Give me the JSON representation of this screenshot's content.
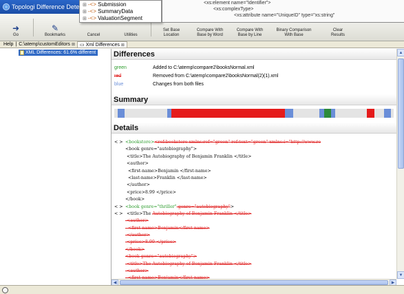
{
  "window": {
    "title": "Topologi Difference Detect"
  },
  "toolbar": {
    "buttons": [
      {
        "label": "Go",
        "icon": "go-icon"
      },
      {
        "label": "Bookmarks",
        "icon": "bookmark-icon"
      },
      {
        "label": "Cancel",
        "icon": ""
      },
      {
        "label": "Utilities",
        "icon": ""
      },
      {
        "label": "Set Base\nLocation",
        "icon": ""
      },
      {
        "label": "Compare With\nBase by Word",
        "icon": ""
      },
      {
        "label": "Compare With\nBase by Line",
        "icon": ""
      },
      {
        "label": "Binary Comparison\nWith Base",
        "icon": ""
      },
      {
        "label": "Clear\nResults",
        "icon": ""
      }
    ]
  },
  "dropdown": {
    "items": [
      "Submission",
      "SummaryData",
      "ValuationSegment"
    ]
  },
  "code_popup": {
    "lines": [
      "<xs:element name=\"Identifier\">",
      "<xs:complexType>",
      "<xs:attribute name=\"UniqueID\" type=\"xs:string\""
    ]
  },
  "tabs": {
    "help": "Help",
    "path_tab": "C:\\atemp\\customEditors",
    "active_tab": "Xml Differences"
  },
  "tree": {
    "selected_item": "XML Differences: 61.6% different"
  },
  "differences": {
    "heading": "Differences",
    "rows": [
      {
        "key": "green",
        "text": "Added to C:\\atemp\\compare2\\booksNormal.xml"
      },
      {
        "key": "red",
        "text": "Removed from C:\\atemp\\compare2\\booksNormal(2)(1).xml"
      },
      {
        "key": "blue",
        "text": "Changes from both files"
      }
    ]
  },
  "summary": {
    "heading": "Summary",
    "segments": [
      {
        "start": 0.013,
        "end": 0.038,
        "color": "#6a8ed8"
      },
      {
        "start": 0.19,
        "end": 0.205,
        "color": "#6a8ed8"
      },
      {
        "start": 0.205,
        "end": 0.61,
        "color": "#e51b1b"
      },
      {
        "start": 0.61,
        "end": 0.64,
        "color": "#6a8ed8"
      },
      {
        "start": 0.735,
        "end": 0.752,
        "color": "#6a8ed8"
      },
      {
        "start": 0.752,
        "end": 0.775,
        "color": "#2c8a3c"
      },
      {
        "start": 0.775,
        "end": 0.79,
        "color": "#6a8ed8"
      },
      {
        "start": 0.905,
        "end": 0.93,
        "color": "#e51b1b"
      },
      {
        "start": 0.965,
        "end": 0.99,
        "color": "#6a8ed8"
      }
    ]
  },
  "details": {
    "heading": "Details",
    "lines": [
      {
        "arrow": "< >",
        "parts": [
          {
            "t": "<bookstore>",
            "s": "add"
          },
          {
            "t": "<ref:bookstore xmlns:ref=\"green\" ref:text=\"green\" xmlns:i=\"http://www.re",
            "s": "del"
          }
        ]
      },
      {
        "arrow": "",
        "parts": [
          {
            "t": "<book genre=\"autobiography\">",
            "s": "plain"
          }
        ]
      },
      {
        "arrow": "",
        "parts": [
          {
            "t": " <title>The Autobiography of Benjamin Franklin </title>",
            "s": "plain"
          }
        ]
      },
      {
        "arrow": "",
        "parts": [
          {
            "t": " <author>",
            "s": "plain"
          }
        ]
      },
      {
        "arrow": "",
        "parts": [
          {
            "t": "  <first-name>Benjamin </first-name>",
            "s": "plain"
          }
        ]
      },
      {
        "arrow": "",
        "parts": [
          {
            "t": "  <last-name>Franklin </last-name>",
            "s": "plain"
          }
        ]
      },
      {
        "arrow": "",
        "parts": [
          {
            "t": " </author>",
            "s": "plain"
          }
        ]
      },
      {
        "arrow": "",
        "parts": [
          {
            "t": " <price>8.99 </price>",
            "s": "plain"
          }
        ]
      },
      {
        "arrow": "",
        "parts": [
          {
            "t": "</book>",
            "s": "plain"
          }
        ]
      },
      {
        "arrow": "< >",
        "parts": [
          {
            "t": "<book genre=\"thriller\"",
            "s": "add"
          },
          {
            "t": " genre=\"autobiography\"",
            "s": "del"
          },
          {
            "t": ">",
            "s": "plain"
          }
        ]
      },
      {
        "arrow": "< >",
        "parts": [
          {
            "t": " <title>The ",
            "s": "plain"
          },
          {
            "t": "Autobiography of Benjamin Franklin </title>",
            "s": "del"
          }
        ]
      },
      {
        "arrow": "",
        "parts": [
          {
            "t": " <author>",
            "s": "del"
          }
        ]
      },
      {
        "arrow": "",
        "parts": [
          {
            "t": "  <first-name>Benjamin</first-name>",
            "s": "del"
          }
        ]
      },
      {
        "arrow": "",
        "parts": [
          {
            "t": " </author>",
            "s": "del"
          }
        ]
      },
      {
        "arrow": "",
        "parts": [
          {
            "t": " <price>8.99 </price>",
            "s": "del"
          }
        ]
      },
      {
        "arrow": "",
        "parts": [
          {
            "t": "</book>",
            "s": "del"
          }
        ]
      },
      {
        "arrow": "",
        "parts": [
          {
            "t": "<book genre=\"autobiography\">",
            "s": "del"
          }
        ]
      },
      {
        "arrow": "",
        "parts": [
          {
            "t": " <title>The Autobiography of Benjamin Franklin </title>",
            "s": "del"
          }
        ]
      },
      {
        "arrow": "",
        "parts": [
          {
            "t": " <author>",
            "s": "del"
          }
        ]
      },
      {
        "arrow": "",
        "parts": [
          {
            "t": "  <first-name>Benjamin</first-name>",
            "s": "del"
          }
        ]
      }
    ]
  },
  "colors": {
    "added": "#2c9c2c",
    "removed": "#e02020",
    "changed": "#6a8ed8",
    "selection": "#316ac5"
  }
}
